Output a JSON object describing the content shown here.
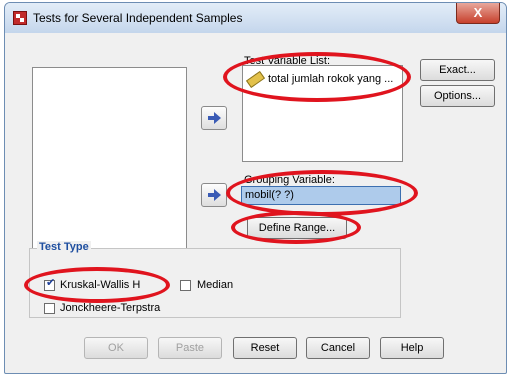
{
  "window": {
    "title": "Tests for Several Independent Samples",
    "close_symbol": "X"
  },
  "test_variable_list": {
    "label": "Test Variable List:",
    "items": [
      {
        "icon": "ruler-scale-icon",
        "label": "total jumlah rokok yang ..."
      }
    ]
  },
  "grouping_variable": {
    "label": "Grouping Variable:",
    "value": "mobil(? ?)"
  },
  "buttons": {
    "exact": "Exact...",
    "options": "Options...",
    "define_range": "Define Range...",
    "ok": "OK",
    "paste": "Paste",
    "reset": "Reset",
    "cancel": "Cancel",
    "help": "Help"
  },
  "test_type": {
    "legend": "Test Type",
    "options": [
      {
        "label": "Kruskal-Wallis H",
        "checked": true
      },
      {
        "label": "Median",
        "checked": false
      },
      {
        "label": "Jonckheere-Terpstra",
        "checked": false
      }
    ]
  },
  "colors": {
    "highlight_ellipse": "#e0141e",
    "selection": "#aecbeb",
    "legend_text": "#1f4fa0"
  }
}
